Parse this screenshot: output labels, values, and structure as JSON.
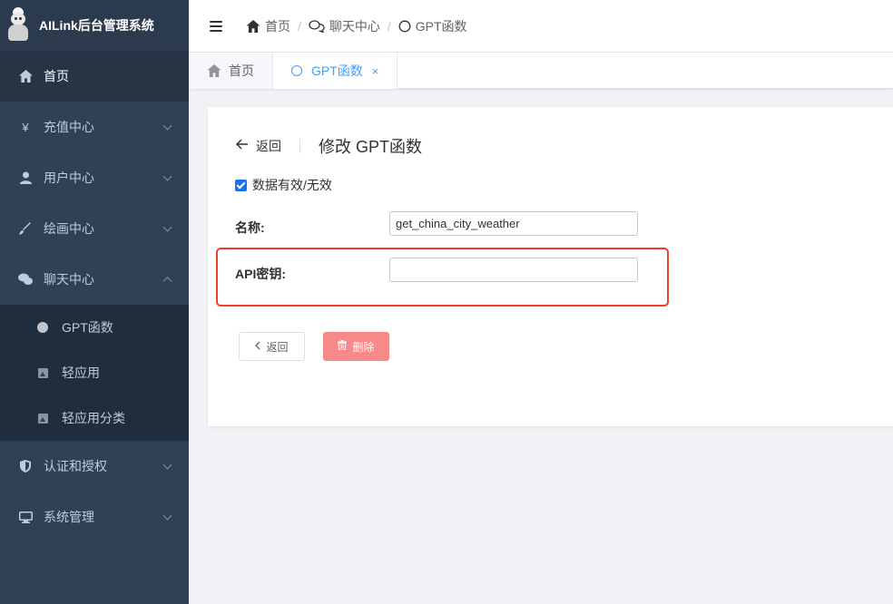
{
  "app": {
    "title": "AILink后台管理系统"
  },
  "sidebar": {
    "items": [
      {
        "label": "首页",
        "icon": "home-icon",
        "active": true
      },
      {
        "label": "充值中心",
        "icon": "yen-icon"
      },
      {
        "label": "用户中心",
        "icon": "user-icon"
      },
      {
        "label": "绘画中心",
        "icon": "brush-icon"
      },
      {
        "label": "聊天中心",
        "icon": "chat-icon",
        "expanded": true
      },
      {
        "label": "认证和授权",
        "icon": "shield-icon"
      },
      {
        "label": "系统管理",
        "icon": "monitor-icon"
      }
    ],
    "chat_submenu": [
      {
        "label": "GPT函数",
        "icon": "circle-icon"
      },
      {
        "label": "轻应用",
        "icon": "image-icon"
      },
      {
        "label": "轻应用分类",
        "icon": "image-icon"
      }
    ]
  },
  "breadcrumb": {
    "items": [
      "首页",
      "聊天中心",
      "GPT函数"
    ],
    "separator": "/"
  },
  "tabs": [
    {
      "label": "首页",
      "icon": "home-icon"
    },
    {
      "label": "GPT函数",
      "icon": "circle-icon",
      "active": true,
      "close": "×"
    }
  ],
  "page": {
    "back_label": "返回",
    "title": "修改 GPT函数",
    "checkbox_label": "数据有效/无效",
    "checkbox_checked": true,
    "fields": {
      "name_label": "名称:",
      "name_value": "get_china_city_weather",
      "api_key_label": "API密钥:",
      "api_key_value": ""
    },
    "buttons": {
      "back": "返回",
      "delete": "删除"
    }
  },
  "colors": {
    "sidebar_bg": "#304156",
    "accent": "#409eff",
    "danger": "#f78989",
    "highlight": "#e8412c"
  }
}
